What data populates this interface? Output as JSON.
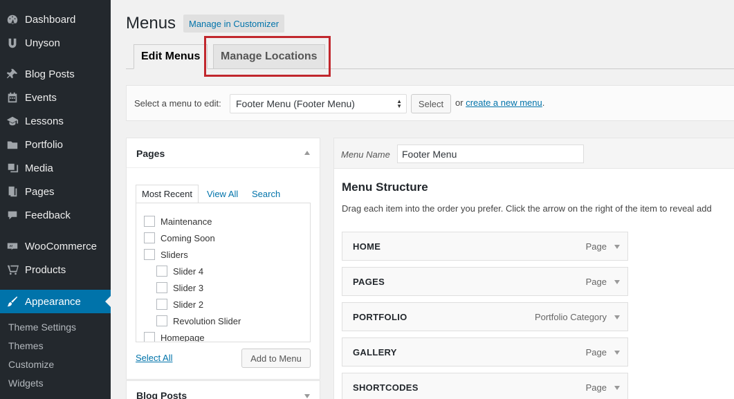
{
  "sidebar": {
    "items": [
      {
        "label": "Dashboard",
        "icon": "dashboard-icon"
      },
      {
        "label": "Unyson",
        "icon": "unyson-icon"
      },
      {
        "label": "Blog Posts",
        "icon": "pin-icon"
      },
      {
        "label": "Events",
        "icon": "calendar-icon"
      },
      {
        "label": "Lessons",
        "icon": "graduation-cap-icon"
      },
      {
        "label": "Portfolio",
        "icon": "folder-icon"
      },
      {
        "label": "Media",
        "icon": "media-icon"
      },
      {
        "label": "Pages",
        "icon": "pages-icon"
      },
      {
        "label": "Feedback",
        "icon": "speech-bubble-icon"
      },
      {
        "label": "WooCommerce",
        "icon": "woocommerce-icon"
      },
      {
        "label": "Products",
        "icon": "cart-icon"
      },
      {
        "label": "Appearance",
        "icon": "paintbrush-icon"
      }
    ],
    "subitems": [
      "Theme Settings",
      "Themes",
      "Customize",
      "Widgets"
    ],
    "active_color": "#0073aa"
  },
  "header": {
    "title": "Menus",
    "customizer_button": "Manage in Customizer"
  },
  "tabs": {
    "edit": "Edit Menus",
    "manage": "Manage Locations"
  },
  "select_bar": {
    "label": "Select a menu to edit:",
    "selected_menu": "Footer Menu (Footer Menu)",
    "select_button": "Select",
    "or_text": "or",
    "create_link": "create a new menu",
    "period": "."
  },
  "pages_panel": {
    "title": "Pages",
    "tabs": [
      "Most Recent",
      "View All",
      "Search"
    ],
    "items": [
      {
        "label": "Maintenance",
        "checked": false
      },
      {
        "label": "Coming Soon",
        "checked": false
      },
      {
        "label": "Sliders",
        "checked": false
      },
      {
        "label": "Slider 4",
        "checked": false
      },
      {
        "label": "Slider 3",
        "checked": false
      },
      {
        "label": "Slider 2",
        "checked": false
      },
      {
        "label": "Revolution Slider",
        "checked": false
      },
      {
        "label": "Homepage",
        "checked": false
      }
    ],
    "select_all": "Select All",
    "add_button": "Add to Menu"
  },
  "blog_panel": {
    "title": "Blog Posts"
  },
  "menu_panel": {
    "name_label": "Menu Name",
    "name_value": "Footer Menu",
    "structure_title": "Menu Structure",
    "structure_desc": "Drag each item into the order you prefer. Click the arrow on the right of the item to reveal add",
    "items": [
      {
        "title": "HOME",
        "type": "Page"
      },
      {
        "title": "PAGES",
        "type": "Page"
      },
      {
        "title": "PORTFOLIO",
        "type": "Portfolio Category"
      },
      {
        "title": "GALLERY",
        "type": "Page"
      },
      {
        "title": "SHORTCODES",
        "type": "Page"
      }
    ]
  },
  "highlight_color": "#c1272d"
}
